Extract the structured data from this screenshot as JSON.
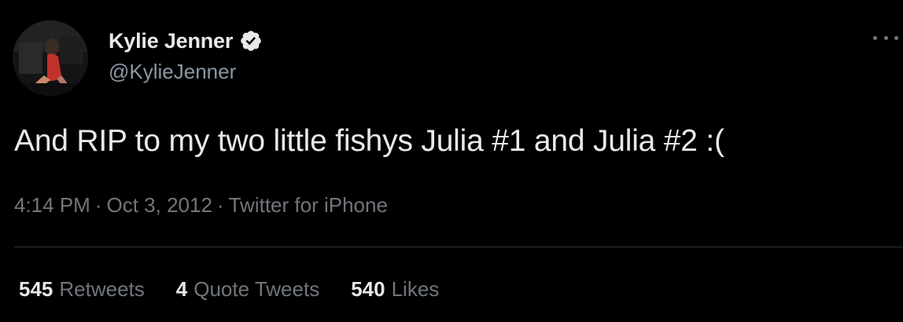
{
  "author": {
    "display_name": "Kylie Jenner",
    "handle": "@KylieJenner",
    "verified_icon": "verified-badge-icon",
    "avatar_icon": "profile-photo"
  },
  "tweet": {
    "text": "And RIP to my two little fishys Julia #1 and Julia #2 :("
  },
  "meta": {
    "time": "4:14 PM",
    "separator": "·",
    "date": "Oct 3, 2012",
    "source": "Twitter for iPhone"
  },
  "stats": {
    "retweets_count": "545",
    "retweets_label": "Retweets",
    "quotes_count": "4",
    "quotes_label": "Quote Tweets",
    "likes_count": "540",
    "likes_label": "Likes"
  },
  "menu": {
    "more_icon": "more-options-icon"
  },
  "colors": {
    "background": "#000000",
    "primary_text": "#e7e9ea",
    "secondary_text": "#71767b",
    "handle_text": "#8b98a5",
    "divider": "#2f3336"
  }
}
